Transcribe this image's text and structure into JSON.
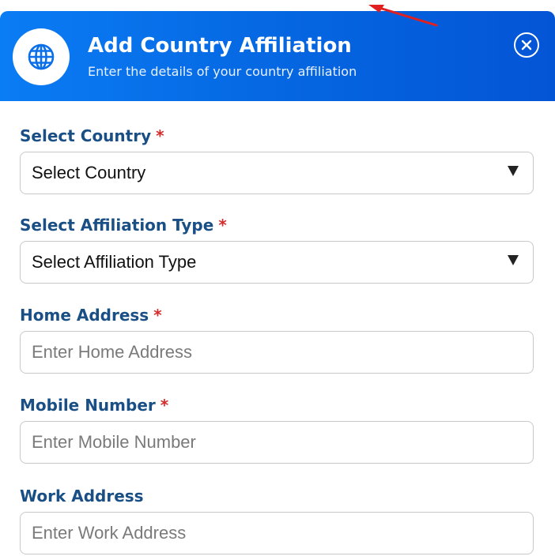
{
  "header": {
    "title": "Add Country Affiliation",
    "subtitle": "Enter the details of your country affiliation"
  },
  "icons": {
    "globe": "globe-icon",
    "close": "close-icon",
    "dropdown": "caret-down-icon"
  },
  "colors": {
    "header_start": "#0a7cf4",
    "header_end": "#0455d6",
    "label": "#1a4f85",
    "required": "#d42a2a",
    "annotation_arrow": "#e02020"
  },
  "form": {
    "country": {
      "label": "Select Country",
      "required_mark": "*",
      "selected": "Select Country"
    },
    "affiliation_type": {
      "label": "Select Affiliation Type",
      "required_mark": "*",
      "selected": "Select Affiliation Type"
    },
    "home_address": {
      "label": "Home Address",
      "required_mark": "*",
      "placeholder": "Enter Home Address",
      "value": ""
    },
    "mobile_number": {
      "label": "Mobile Number",
      "required_mark": "*",
      "placeholder": "Enter Mobile Number",
      "value": ""
    },
    "work_address": {
      "label": "Work Address",
      "placeholder": "Enter Work Address",
      "value": ""
    }
  }
}
